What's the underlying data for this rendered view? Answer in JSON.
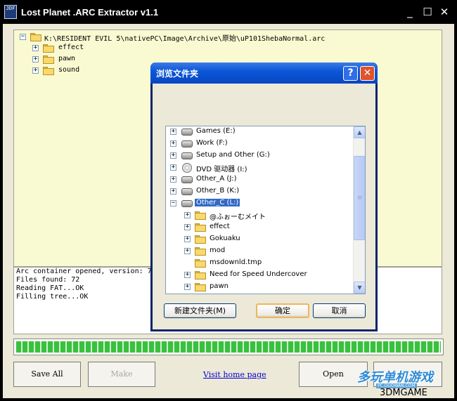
{
  "window": {
    "title": "Lost Planet .ARC Extractor v1.1",
    "icon_text": "JDF",
    "controls": {
      "minimize": "_",
      "maximize": "☐",
      "close": "✕"
    }
  },
  "tree": {
    "root_path": "K:\\RESIDENT EVIL 5\\nativePC\\Image\\Archive\\原始\\uP101ShebaNormal.arc",
    "children": [
      "effect",
      "pawn",
      "sound"
    ]
  },
  "log": {
    "lines": [
      "Arc container opened, version: 7",
      "Files found: 72",
      "Reading FAT...OK",
      "Filling tree...OK"
    ]
  },
  "progress": {
    "value": 1.0,
    "fill_color": "#39c13d"
  },
  "buttons": {
    "save_all": "Save All",
    "make": "Make",
    "visit_link": "Visit home page",
    "open": "Open"
  },
  "dialog": {
    "title": "浏览文件夹",
    "help": "?",
    "close": "✕",
    "items": [
      {
        "label": "Games (E:)",
        "icon": "drive-icon"
      },
      {
        "label": "Work (F:)",
        "icon": "drive-icon"
      },
      {
        "label": "Setup and Other (G:)",
        "icon": "drive-icon"
      },
      {
        "label": "DVD 驱动器 (I:)",
        "icon": "dvd-icon"
      },
      {
        "label": "Other_A (J:)",
        "icon": "drive-icon"
      },
      {
        "label": "Other_B (K:)",
        "icon": "drive-icon"
      },
      {
        "label": "Other_C (L:)",
        "icon": "drive-icon",
        "selected": true
      }
    ],
    "subitems": [
      "@ふぉーむメイト",
      "effect",
      "Gokuaku",
      "mod",
      "msdownld.tmp",
      "Need for Speed Undercover",
      "pawn"
    ],
    "new_folder_label": "新建文件夹(M)",
    "ok_label": "确定",
    "cancel_label": "取消",
    "scroll_up": "▲",
    "scroll_down": "▼",
    "thumb_grip": "≡"
  },
  "watermark": {
    "logo_text": "多玩单机游戏",
    "site_text": "PC.DUOWAN.COM",
    "brand": "3DMGAME"
  },
  "colors": {
    "titlebar": "#000000",
    "client_bg": "#ece9d8",
    "tree_bg": "#fafad2",
    "dialog_title": "#0a58d8",
    "selection": "#316ac5",
    "link": "#0000cc"
  }
}
